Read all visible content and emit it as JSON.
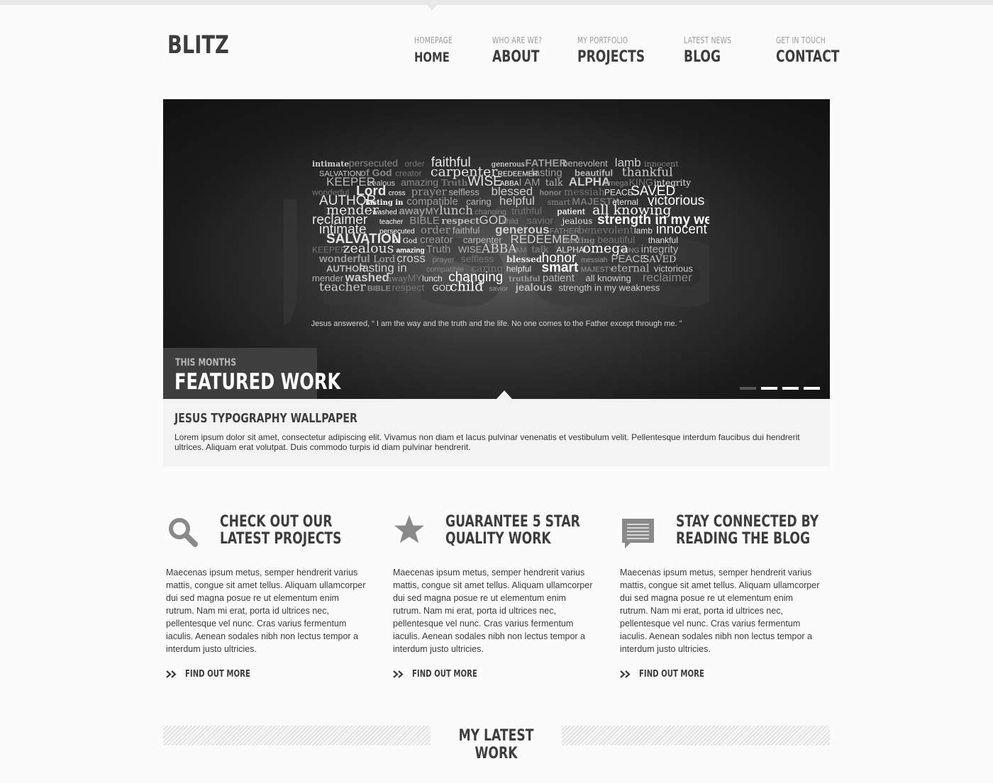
{
  "brand": {
    "logo": "BLITZ"
  },
  "nav": [
    {
      "sub": "HOMEPAGE",
      "main": "HOME"
    },
    {
      "sub": "WHO ARE WE?",
      "main": "ABOUT"
    },
    {
      "sub": "MY PORTFOLIO",
      "main": "PROJECTS"
    },
    {
      "sub": "LATEST NEWS",
      "main": "BLOG"
    },
    {
      "sub": "GET IN TOUCH",
      "main": "CONTACT"
    }
  ],
  "hero": {
    "words": [
      "intimate",
      "persecuted",
      "order",
      "faithful",
      "generous",
      "FATHER",
      "benevolent",
      "lamb",
      "innocent",
      "SALVATION",
      "of God",
      "creator",
      "carpenter",
      "REDEEMER",
      "lasting",
      "beautiful",
      "thankful",
      "KEEPER",
      "zealous",
      "amazing",
      "Truth",
      "WISE",
      "ABBA",
      "I AM",
      "talk",
      "ALPHA",
      "omega",
      "KING",
      "integrity",
      "wonderful",
      "Lord",
      "cross",
      "prayer",
      "selfless",
      "blessed",
      "honor",
      "messiah",
      "PEACE",
      "SAVED",
      "AUTHOR",
      "lasting in",
      "compatible",
      "caring",
      "helpful",
      "smart",
      "MAJESTY",
      "eternal",
      "victorious",
      "mender",
      "washed",
      "away",
      "MY",
      "lunch",
      "changing",
      "truthful",
      "patient",
      "all knowing",
      "reclaimer",
      "teacher",
      "BIBLE",
      "respect",
      "GOD",
      "child",
      "savior",
      "jealous",
      "strength in my weakness"
    ],
    "quote": "Jesus answered, “ I am the way and the truth and the life. No one comes to the Father except through me. ”",
    "featured_sub": "THIS MONTHS",
    "featured_title": "FEATURED WORK",
    "slides": 4,
    "active_slide": 0
  },
  "caption": {
    "title": "JESUS TYPOGRAPHY WALLPAPER",
    "text": "Lorem ipsum dolor sit amet, consectetur adipiscing elit. Vivamus non diam et lacus pulvinar venenatis et vestibulum velit. Pellentesque interdum faucibus dui hendrerit ultrices. Aliquam erat volutpat. Duis commodo turpis id diam pulvinar hendrerit."
  },
  "features": [
    {
      "icon": "search-icon",
      "heading": "CHECK OUT OUR LATEST PROJECTS",
      "text": "Maecenas ipsum metus, semper hendrerit varius mattis, congue sit amet tellus. Aliquam ullamcorper dui sed magna posue re ut elementum enim rutrum. Nam mi erat, porta id ultrices nec, pellentesque vel nunc. Cras varius fermentum iaculis. Aenean sodales nibh non lectus tempor a interdum justo ultricies.",
      "link": "FIND OUT MORE"
    },
    {
      "icon": "star-icon",
      "heading": "GUARANTEE 5 STAR QUALITY WORK",
      "text": "Maecenas ipsum metus, semper hendrerit varius mattis, congue sit amet tellus. Aliquam ullamcorper dui sed magna posue re ut elementum enim rutrum. Nam mi erat, porta id ultrices nec, pellentesque vel nunc. Cras varius fermentum iaculis. Aenean sodales nibh non lectus tempor a interdum justo ultricies.",
      "link": "FIND OUT MORE"
    },
    {
      "icon": "chat-bubble-icon",
      "heading": "STAY CONNECTED BY READING THE BLOG",
      "text": "Maecenas ipsum metus, semper hendrerit varius mattis, congue sit amet tellus. Aliquam ullamcorper dui sed magna posue re ut elementum enim rutrum. Nam mi erat, porta id ultrices nec, pellentesque vel nunc. Cras varius fermentum iaculis. Aenean sodales nibh non lectus tempor a interdum justo ultricies.",
      "link": "FIND OUT MORE"
    }
  ],
  "latest": {
    "title": "MY LATEST WORK"
  },
  "colors": {
    "text": "#3d3d3d",
    "muted": "#9a9a9a",
    "hero_bg": "#1b1b1b",
    "panel": "#f3f3f3",
    "quote_mark": "#cc2222"
  }
}
